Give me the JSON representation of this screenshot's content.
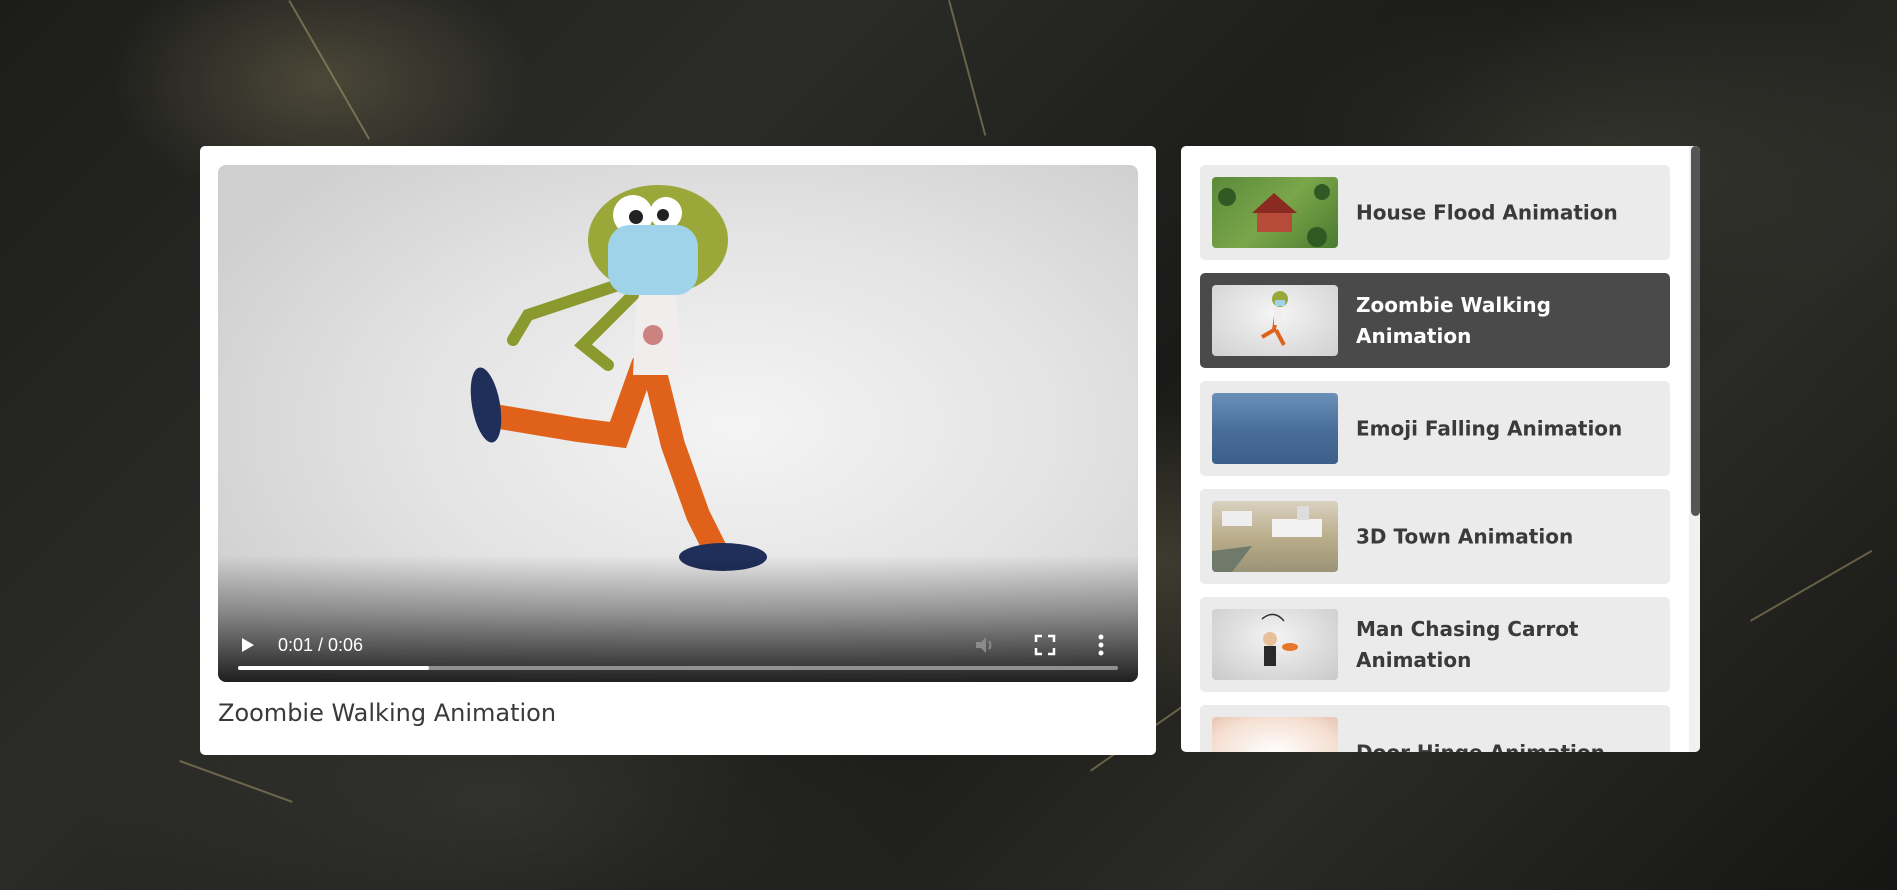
{
  "player": {
    "time_display": "0:01 / 0:06",
    "progress_fraction": 0.217,
    "title": "Zoombie Walking Animation"
  },
  "playlist": {
    "items": [
      {
        "label": "House Flood Animation",
        "thumbnail": "house-flood-thumbnail",
        "active": false
      },
      {
        "label": "Zoombie Walking Animation",
        "thumbnail": "zombie-walking-thumbnail",
        "active": true
      },
      {
        "label": "Emoji Falling Animation",
        "thumbnail": "emoji-falling-thumbnail",
        "active": false
      },
      {
        "label": "3D Town Animation",
        "thumbnail": "3d-town-thumbnail",
        "active": false
      },
      {
        "label": "Man Chasing Carrot Animation",
        "thumbnail": "man-chasing-carrot-thumbnail",
        "active": false
      },
      {
        "label": "Door Hinge Animation",
        "thumbnail": "door-hinge-thumbnail",
        "active": false
      }
    ]
  },
  "colors": {
    "active_item_bg": "#4a4a4a",
    "item_bg": "#ebebeb",
    "title_text": "#3a3a3a"
  }
}
